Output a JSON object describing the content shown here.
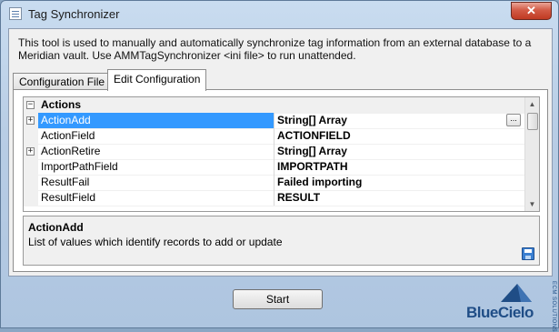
{
  "window": {
    "title": "Tag Synchronizer",
    "close_label": "✕"
  },
  "description": "This tool is used to manually and automatically synchronize tag information from an external database to a Meridian vault. Use AMMTagSynchronizer <ini file> to run unattended.",
  "tabs": [
    {
      "label": "Configuration File",
      "active": false
    },
    {
      "label": "Edit Configuration",
      "active": true
    }
  ],
  "grid": {
    "category": {
      "name": "Actions",
      "expander": "−"
    },
    "rows": [
      {
        "name": "ActionAdd",
        "value": "String[] Array",
        "expander": "+",
        "selected": true,
        "ellipsis": "..."
      },
      {
        "name": "ActionField",
        "value": "ACTIONFIELD",
        "expander": ""
      },
      {
        "name": "ActionRetire",
        "value": "String[] Array",
        "expander": "+"
      },
      {
        "name": "ImportPathField",
        "value": "IMPORTPATH",
        "expander": ""
      },
      {
        "name": "ResultFail",
        "value": "Failed importing",
        "expander": ""
      },
      {
        "name": "ResultField",
        "value": "RESULT",
        "expander": ""
      }
    ]
  },
  "help": {
    "title": "ActionAdd",
    "description": "List of values which identify records to add or update"
  },
  "start_button": {
    "label": "Start"
  },
  "logo": {
    "name": "BlueCielo",
    "tagline": "ECM SOLUTIONS",
    "brand_color": "#1f4d86"
  },
  "colors": {
    "selection": "#3399ff",
    "close_button": "#c03a22"
  }
}
